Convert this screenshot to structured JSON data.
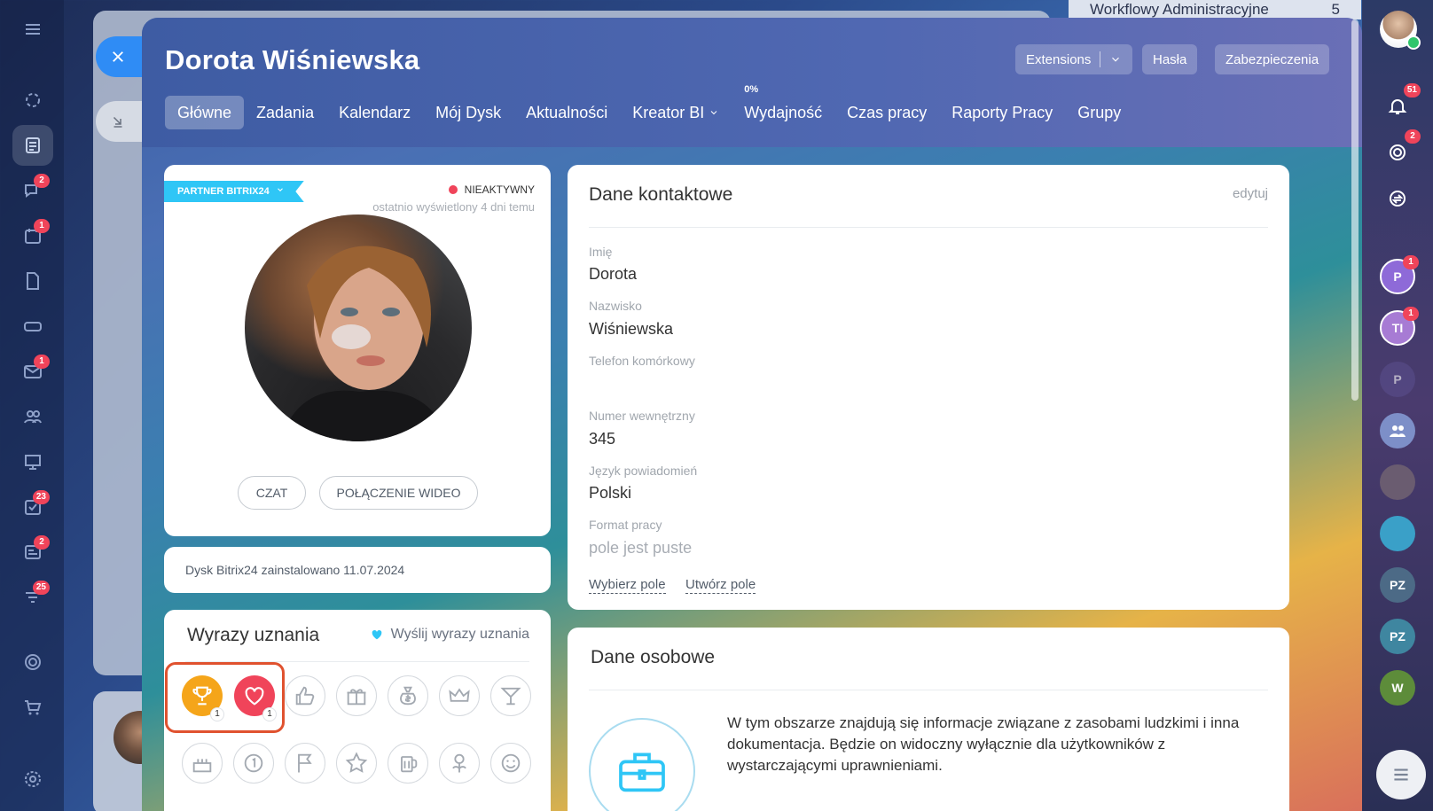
{
  "left_sidebar": {
    "items": [
      {
        "icon": "menu-icon",
        "badge": ""
      },
      {
        "icon": "activity-stream-icon",
        "badge": ""
      },
      {
        "icon": "document-icon",
        "badge": ""
      },
      {
        "icon": "chat-icon",
        "badge": "2"
      },
      {
        "icon": "calendar-icon",
        "badge": "1"
      },
      {
        "icon": "file-icon",
        "badge": ""
      },
      {
        "icon": "drive-icon",
        "badge": ""
      },
      {
        "icon": "mail-icon",
        "badge": "1"
      },
      {
        "icon": "people-icon",
        "badge": ""
      },
      {
        "icon": "presentation-icon",
        "badge": ""
      },
      {
        "icon": "tasks-icon",
        "badge": "23"
      },
      {
        "icon": "news-icon",
        "badge": "2"
      },
      {
        "icon": "funnel-icon",
        "badge": "25"
      },
      {
        "icon": "target-icon",
        "badge": ""
      },
      {
        "icon": "cart-icon",
        "badge": ""
      },
      {
        "icon": "settings-icon",
        "badge": ""
      }
    ]
  },
  "background": {
    "workflow_label": "Workflowy Administracyjne",
    "workflow_count": "5"
  },
  "right_sidebar": {
    "notifications_badge": "51",
    "second_badge": "2",
    "avatars": [
      {
        "label": "P",
        "badge": "1",
        "color": "#8e6ad8"
      },
      {
        "label": "TI",
        "badge": "1",
        "color": "#a77bd4"
      },
      {
        "label": "P",
        "badge": "",
        "color": "#5a4e8c"
      },
      {
        "label": "",
        "badge": "",
        "color": "#7d8fc8"
      },
      {
        "label": "",
        "badge": "",
        "color": "#6a5c70"
      },
      {
        "label": "",
        "badge": "",
        "color": "#3aa0c8"
      },
      {
        "label": "PZ",
        "badge": "",
        "color": "#4c6a86"
      },
      {
        "label": "PZ",
        "badge": "",
        "color": "#3f86a0"
      },
      {
        "label": "W",
        "badge": "",
        "color": "#5d8c3a"
      }
    ]
  },
  "header": {
    "title": "Dorota Wiśniewska",
    "extensions_label": "Extensions",
    "passwords_label": "Hasła",
    "security_label": "Zabezpieczenia"
  },
  "tabs": [
    {
      "label": "Główne",
      "active": true
    },
    {
      "label": "Zadania"
    },
    {
      "label": "Kalendarz"
    },
    {
      "label": "Mój Dysk"
    },
    {
      "label": "Aktualności"
    },
    {
      "label": "Kreator BI"
    },
    {
      "label": "Wydajność",
      "sup": "0%"
    },
    {
      "label": "Czas pracy"
    },
    {
      "label": "Raporty Pracy"
    },
    {
      "label": "Grupy"
    }
  ],
  "profile": {
    "partner_label": "PARTNER BITRIX24",
    "status": "NIEAKTYWNY",
    "last_seen": "ostatnio wyświetlony 4 dni temu",
    "chat_label": "CZAT",
    "video_label": "POŁĄCZENIE WIDEO",
    "status_color": "#f0445a"
  },
  "disk_info": "Dysk Bitrix24 zainstalowano 11.07.2024",
  "kudos": {
    "title": "Wyrazy uznania",
    "send_label": "Wyślij wyrazy uznania",
    "received": [
      {
        "icon": "trophy-icon",
        "count": "1",
        "color": "#f5a51a"
      },
      {
        "icon": "heart-icon",
        "count": "1",
        "color": "#f0445a"
      }
    ],
    "available_row1": [
      "thumbs-up-icon",
      "gift-icon",
      "money-bag-icon",
      "crown-icon",
      "cocktail-icon"
    ],
    "available_row2": [
      "cake-icon",
      "medal-one-icon",
      "flag-icon",
      "star-icon",
      "beer-icon",
      "flower-icon",
      "smile-icon"
    ]
  },
  "contact": {
    "title": "Dane kontaktowe",
    "edit_label": "edytuj",
    "fields": [
      {
        "label": "Imię",
        "value": "Dorota"
      },
      {
        "label": "Nazwisko",
        "value": "Wiśniewska"
      },
      {
        "label": "Telefon komórkowy",
        "value": ""
      },
      {
        "label": "Numer wewnętrzny",
        "value": "345"
      },
      {
        "label": "Język powiadomień",
        "value": "Polski"
      },
      {
        "label": "Format pracy",
        "value": "pole jest puste"
      }
    ],
    "select_field_label": "Wybierz pole",
    "create_field_label": "Utwórz pole"
  },
  "personal": {
    "title": "Dane osobowe",
    "text": "W tym obszarze znajdują się informacje związane z zasobami ludzkimi i inna dokumentacja. Będzie on widoczny wyłącznie dla użytkowników z wystarczającymi uprawnieniami."
  }
}
